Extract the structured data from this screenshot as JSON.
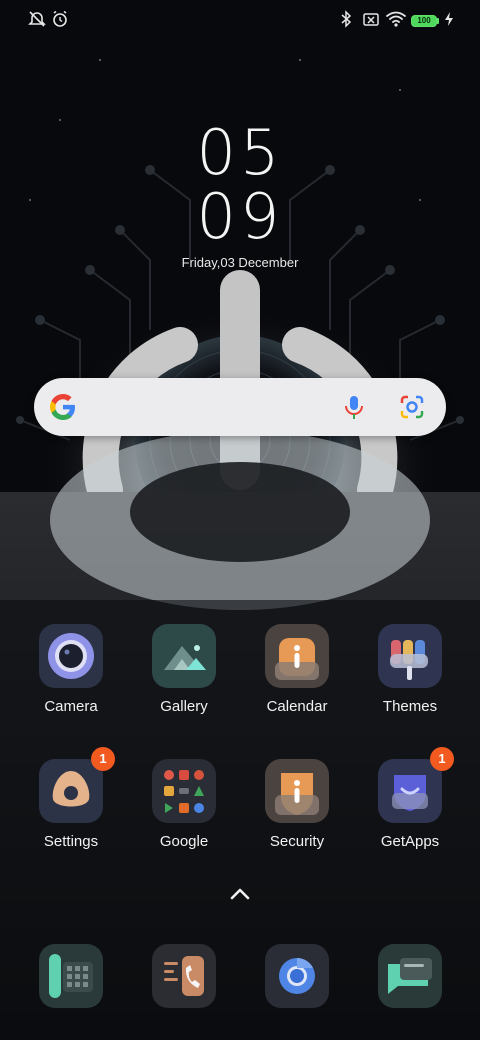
{
  "status_bar": {
    "left_icons": [
      "alarm-off-icon",
      "alarm-clock-icon"
    ],
    "right_icons": [
      "bluetooth-icon",
      "no-sim-icon",
      "wifi-icon",
      "battery-icon",
      "charging-icon"
    ],
    "battery_level": "100"
  },
  "clock": {
    "hours": "05",
    "minutes": "09",
    "date": "Friday,03 December"
  },
  "search": {
    "icons": [
      "google-logo",
      "microphone-icon",
      "google-lens-icon"
    ]
  },
  "apps": [
    {
      "label": "Camera",
      "icon": "camera-icon"
    },
    {
      "label": "Gallery",
      "icon": "gallery-icon"
    },
    {
      "label": "Calendar",
      "icon": "calendar-icon"
    },
    {
      "label": "Themes",
      "icon": "themes-icon"
    },
    {
      "label": "Settings",
      "icon": "settings-icon",
      "badge": "1"
    },
    {
      "label": "Google",
      "icon": "google-folder-icon"
    },
    {
      "label": "Security",
      "icon": "security-icon"
    },
    {
      "label": "GetApps",
      "icon": "getapps-icon",
      "badge": "1"
    }
  ],
  "dock": [
    {
      "icon": "dock-app-1-icon"
    },
    {
      "icon": "phone-icon"
    },
    {
      "icon": "chrome-icon"
    },
    {
      "icon": "messages-icon"
    }
  ],
  "colors": {
    "background": "#08090c",
    "badge": "#f25a1f",
    "search_bar": "#ececee",
    "battery": "#4fd85c"
  }
}
